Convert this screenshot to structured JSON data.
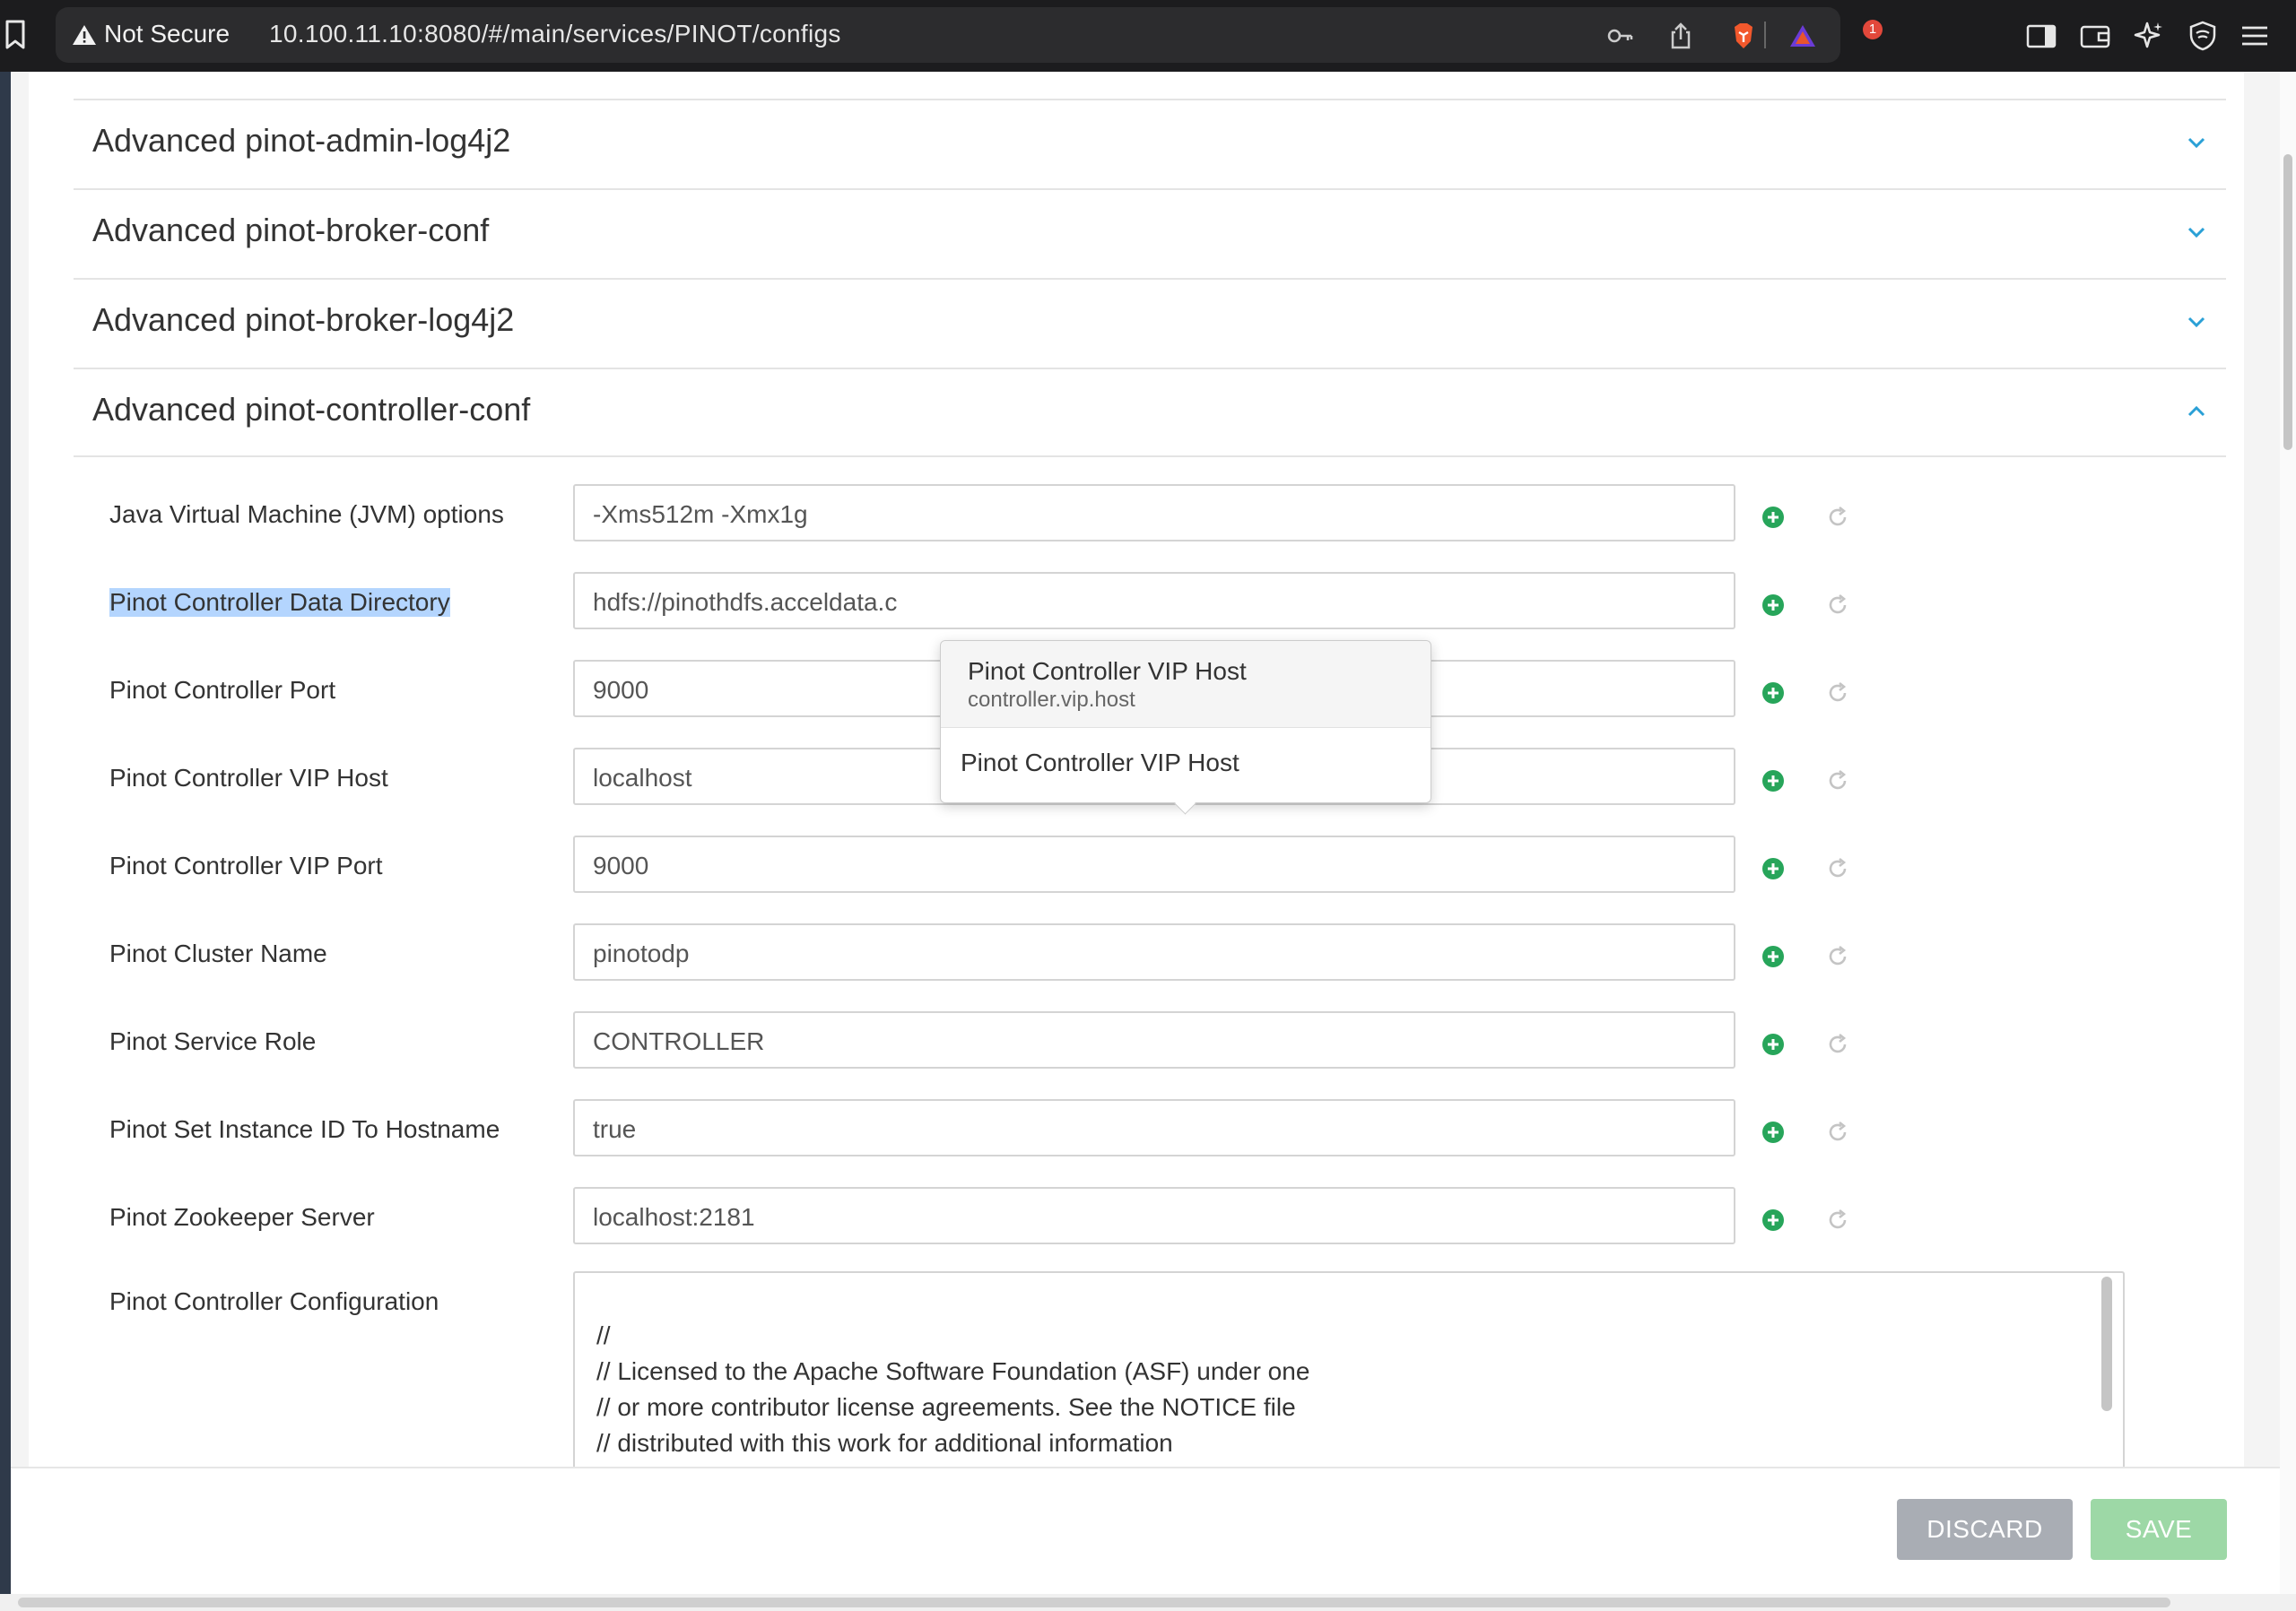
{
  "browser": {
    "security_label": "Not Secure",
    "url": "10.100.11.10:8080/#/main/services/PINOT/configs",
    "notification_count": "1"
  },
  "sections": [
    {
      "title": "Advanced pinot-admin-log4j2",
      "expanded": false
    },
    {
      "title": "Advanced pinot-broker-conf",
      "expanded": false
    },
    {
      "title": "Advanced pinot-broker-log4j2",
      "expanded": false
    },
    {
      "title": "Advanced pinot-controller-conf",
      "expanded": true
    }
  ],
  "config_rows": [
    {
      "label": "Java Virtual Machine (JVM) options",
      "value": "-Xms512m -Xmx1g"
    },
    {
      "label": "Pinot Controller Data Directory",
      "value": "hdfs://pinothdfs.acceldata.c"
    },
    {
      "label": "Pinot Controller Port",
      "value": "9000"
    },
    {
      "label": "Pinot Controller VIP Host",
      "value": "localhost"
    },
    {
      "label": "Pinot Controller VIP Port",
      "value": "9000"
    },
    {
      "label": "Pinot Cluster Name",
      "value": "pinotodp"
    },
    {
      "label": "Pinot Service Role",
      "value": "CONTROLLER"
    },
    {
      "label": "Pinot Set Instance ID To Hostname",
      "value": "true"
    },
    {
      "label": "Pinot Zookeeper Server",
      "value": "localhost:2181"
    }
  ],
  "controller_config": {
    "label": "Pinot Controller Configuration",
    "lines": [
      "//",
      "// Licensed to the Apache Software Foundation (ASF) under one",
      "// or more contributor license agreements.  See the NOTICE file",
      "// distributed with this work for additional information"
    ]
  },
  "tooltip": {
    "title": "Pinot Controller VIP Host",
    "property": "controller.vip.host",
    "description": "Pinot Controller VIP Host"
  },
  "footer": {
    "discard_label": "DISCARD",
    "save_label": "SAVE"
  },
  "colors": {
    "accent": "#2aa0d6",
    "add_green": "#27a55a",
    "selection": "#b4d5fe",
    "discard": "#a9adb4",
    "save": "#9dd8a6"
  }
}
